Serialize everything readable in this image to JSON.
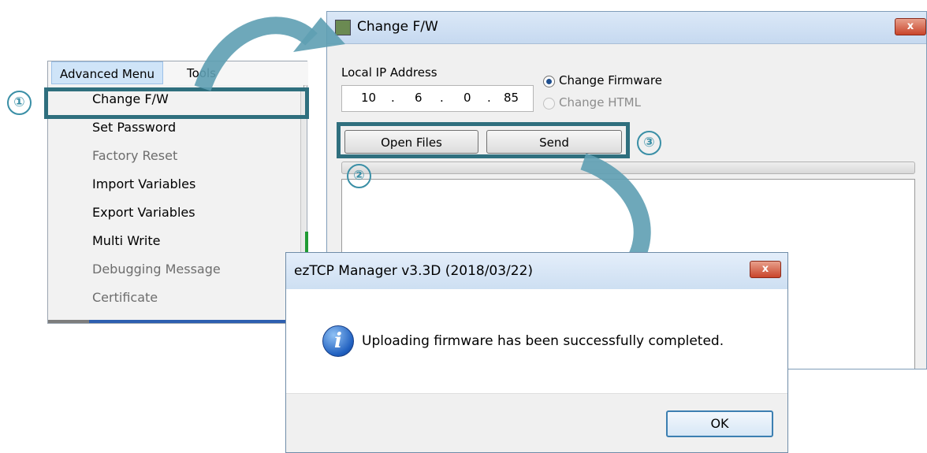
{
  "steps": {
    "one": "①",
    "two": "②",
    "three": "③"
  },
  "menu": {
    "bar": [
      "Advanced Menu",
      "Tools"
    ],
    "items": [
      {
        "label": "Change F/W",
        "enabled": true
      },
      {
        "label": "Set Password",
        "enabled": true
      },
      {
        "label": "Factory Reset",
        "enabled": false
      },
      {
        "label": "Import Variables",
        "enabled": true
      },
      {
        "label": "Export Variables",
        "enabled": true
      },
      {
        "label": "Multi Write",
        "enabled": true
      },
      {
        "label": "Debugging Message",
        "enabled": false
      },
      {
        "label": "Certificate",
        "enabled": false
      }
    ]
  },
  "fw_dialog": {
    "title": "Change F/W",
    "close_icon": "close-icon",
    "ip_label": "Local IP Address",
    "ip_octets": [
      "10",
      "6",
      "0",
      "85"
    ],
    "ip_dot": ".",
    "options": [
      {
        "label": "Change Firmware",
        "selected": true,
        "enabled": true
      },
      {
        "label": "Change HTML",
        "selected": false,
        "enabled": false
      }
    ],
    "open_files_label": "Open Files",
    "send_label": "Send"
  },
  "message_box": {
    "title": "ezTCP Manager v3.3D (2018/03/22)",
    "icon": "info-icon",
    "icon_glyph": "i",
    "close_glyph": "x",
    "text": "Uploading firmware has been successfully completed.",
    "ok_label": "OK"
  },
  "colors": {
    "highlight": "#2f6f7e",
    "arrow": "#5e9fb3",
    "menu_active": "#cfe4f8"
  }
}
